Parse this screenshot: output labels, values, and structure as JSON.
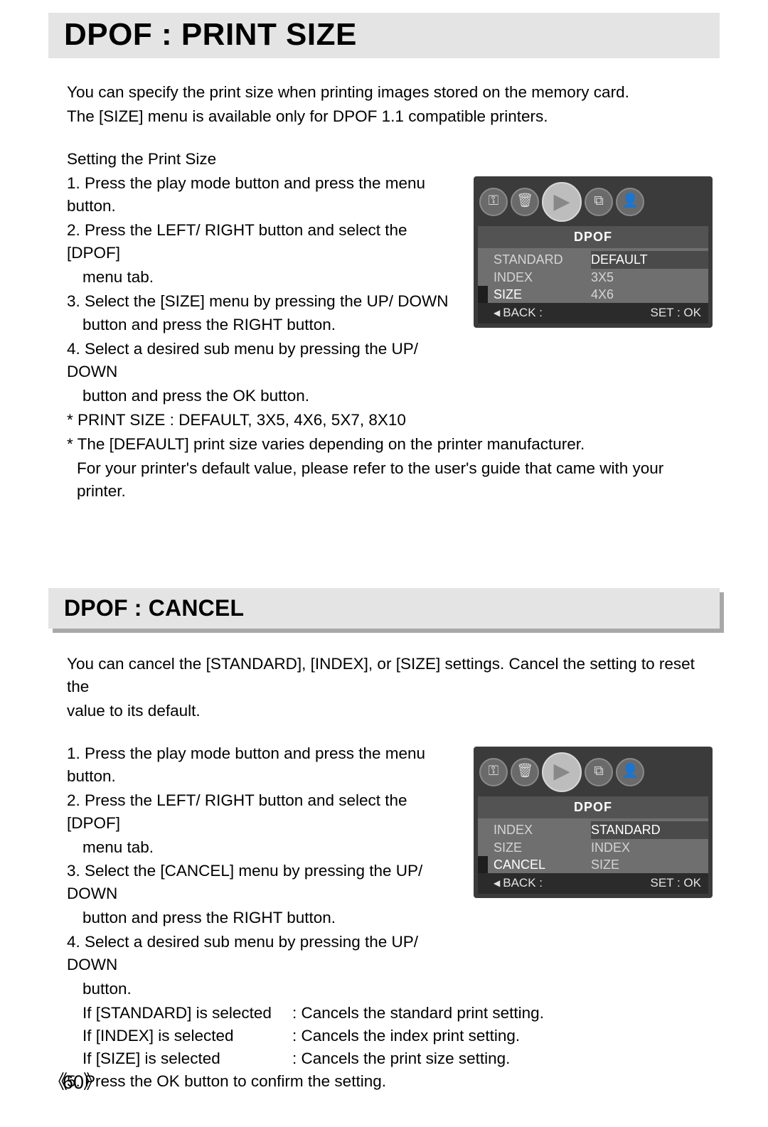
{
  "page_number": "60",
  "section1": {
    "title": "DPOF : PRINT SIZE",
    "intro1": "You can specify the print size when printing images stored on the memory card.",
    "intro2": "The [SIZE] menu is available only for DPOF 1.1 compatible printers.",
    "heading": "Setting the Print Size",
    "steps": {
      "s1": "1. Press the play mode button and press the menu button.",
      "s2a": "2. Press the LEFT/ RIGHT button and select the [DPOF]",
      "s2b": "menu tab.",
      "s3a": "3. Select the [SIZE] menu by pressing the UP/ DOWN",
      "s3b": "button and press the RIGHT button.",
      "s4a": "4. Select a desired sub menu by pressing the UP/ DOWN",
      "s4b": "button and press the OK button."
    },
    "note1": "* PRINT SIZE : DEFAULT, 3X5, 4X6, 5X7, 8X10",
    "note2": "* The [DEFAULT] print size varies depending on the printer manufacturer.",
    "note3": "For your printer's default value, please refer to the user's guide that came with your printer.",
    "lcd": {
      "header": "DPOF",
      "rows": [
        {
          "l": "STANDARD",
          "r": "DEFAULT"
        },
        {
          "l": "INDEX",
          "r": "3X5"
        },
        {
          "l": "SIZE",
          "r": "4X6"
        }
      ],
      "footer_left": "BACK :",
      "footer_right": "SET : OK"
    }
  },
  "section2": {
    "title": "DPOF : CANCEL",
    "intro1": "You can cancel the [STANDARD], [INDEX], or [SIZE] settings. Cancel the setting to reset the",
    "intro2": "value to its default.",
    "steps": {
      "s1": "1. Press the play mode button and press the menu button.",
      "s2a": "2. Press the LEFT/ RIGHT button and select the [DPOF]",
      "s2b": "menu tab.",
      "s3a": "3. Select the [CANCEL] menu by pressing the UP/ DOWN",
      "s3b": "button and press the RIGHT button.",
      "s4a": "4. Select a desired sub menu by pressing the UP/ DOWN",
      "s4b": "button."
    },
    "ifs": {
      "a_t": "If [STANDARD] is selected",
      "a_d": ": Cancels the standard print setting.",
      "b_t": "If [INDEX] is selected",
      "b_d": ": Cancels the index print setting.",
      "c_t": "If [SIZE] is selected",
      "c_d": ": Cancels the print size setting."
    },
    "step5": "5. Press the OK button to confirm the setting.",
    "lcd": {
      "header": "DPOF",
      "rows": [
        {
          "l": "INDEX",
          "r": "STANDARD"
        },
        {
          "l": "SIZE",
          "r": "INDEX"
        },
        {
          "l": "CANCEL",
          "r": "SIZE"
        }
      ],
      "footer_left": "BACK :",
      "footer_right": "SET : OK"
    }
  },
  "icons": {
    "key": "⚿",
    "trash": "🗑",
    "play": "▶",
    "slides": "⧉",
    "person": "👤"
  }
}
